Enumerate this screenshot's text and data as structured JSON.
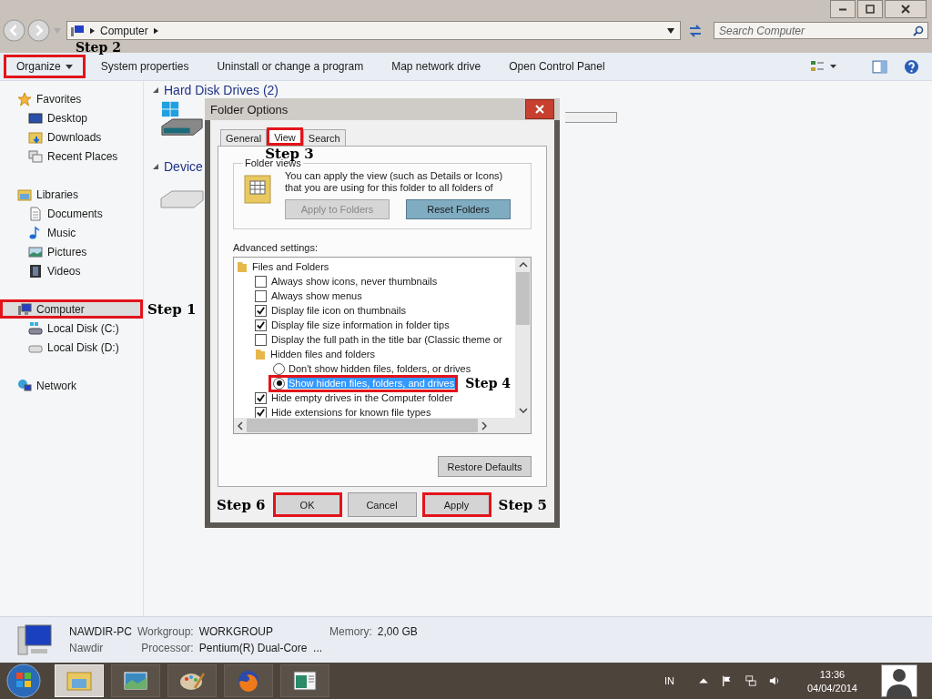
{
  "address_bar": {
    "path": "Computer",
    "search_placeholder": "Search Computer"
  },
  "toolbar": {
    "items": [
      {
        "label": "Organize",
        "dropdown": true,
        "step": "Step 2"
      },
      {
        "label": "System properties",
        "dropdown": false
      },
      {
        "label": "Uninstall or change a program",
        "dropdown": false
      },
      {
        "label": "Map network drive",
        "dropdown": false
      },
      {
        "label": "Open Control Panel",
        "dropdown": false
      }
    ]
  },
  "sidebar": {
    "groups": [
      {
        "label": "Favorites",
        "selected": false,
        "children": [
          {
            "label": "Desktop",
            "selected": false
          },
          {
            "label": "Downloads",
            "selected": false
          },
          {
            "label": "Recent Places",
            "selected": false
          }
        ]
      },
      {
        "label": "Libraries",
        "selected": false,
        "children": [
          {
            "label": "Documents",
            "selected": false
          },
          {
            "label": "Music",
            "selected": false
          },
          {
            "label": "Pictures",
            "selected": false
          },
          {
            "label": "Videos",
            "selected": false
          }
        ]
      },
      {
        "label": "Computer",
        "selected": true,
        "step": "Step 1",
        "children": [
          {
            "label": "Local Disk (C:)",
            "selected": false
          },
          {
            "label": "Local Disk (D:)",
            "selected": false
          }
        ]
      },
      {
        "label": "Network",
        "selected": false
      }
    ]
  },
  "content": {
    "sections": [
      {
        "title": "Hard Disk Drives (2)"
      },
      {
        "title": "Device"
      }
    ]
  },
  "dialog": {
    "title": "Folder Options",
    "tabs": [
      {
        "label": "General",
        "selected": false
      },
      {
        "label": "View",
        "selected": true,
        "step": "Step 3"
      },
      {
        "label": "Search",
        "selected": false
      }
    ],
    "folder_views": {
      "legend": "Folder views",
      "text": "You can apply the view (such as Details or Icons) that you are using for this folder to all folders of",
      "buttons": [
        {
          "label": "Apply to Folders",
          "disabled": true
        },
        {
          "label": "Reset Folders",
          "disabled": false
        }
      ]
    },
    "advanced_label": "Advanced settings:",
    "items": [
      {
        "kind": "folder",
        "label": "Files and Folders",
        "children": [
          {
            "kind": "checkbox",
            "label": "Always show icons, never thumbnails",
            "checked": false
          },
          {
            "kind": "checkbox",
            "label": "Always show menus",
            "checked": false
          },
          {
            "kind": "checkbox",
            "label": "Display file icon on thumbnails",
            "checked": true
          },
          {
            "kind": "checkbox",
            "label": "Display file size information in folder tips",
            "checked": true
          },
          {
            "kind": "checkbox",
            "label": "Display the full path in the title bar (Classic theme or",
            "checked": false
          },
          {
            "kind": "folder",
            "label": "Hidden files and folders",
            "children": [
              {
                "kind": "radio",
                "label": "Don't show hidden files, folders, or drives",
                "selected": false
              },
              {
                "kind": "radio",
                "label": "Show hidden files, folders, and drives",
                "selected": true,
                "step": "Step 4"
              }
            ]
          },
          {
            "kind": "checkbox",
            "label": "Hide empty drives in the Computer folder",
            "checked": true
          },
          {
            "kind": "checkbox",
            "label": "Hide extensions for known file types",
            "checked": true
          }
        ]
      }
    ],
    "restore_button": "Restore Defaults",
    "buttons": [
      {
        "label": "OK",
        "step": "Step 6"
      },
      {
        "label": "Cancel"
      },
      {
        "label": "Apply",
        "step": "Step 5"
      }
    ]
  },
  "status": {
    "name": "NAWDIR-PC",
    "user": "Nawdir",
    "workgroup_label": "Workgroup:",
    "workgroup": "WORKGROUP",
    "memory_label": "Memory:",
    "memory": "2,00 GB",
    "processor_label": "Processor:",
    "processor": "Pentium(R) Dual-Core  ..."
  },
  "taskbar": {
    "apps": [
      {
        "selected": true
      },
      {
        "selected": false
      },
      {
        "selected": false
      },
      {
        "selected": false
      },
      {
        "selected": false
      }
    ],
    "language": "IN",
    "time": "13:36",
    "date": "04/04/2014"
  }
}
